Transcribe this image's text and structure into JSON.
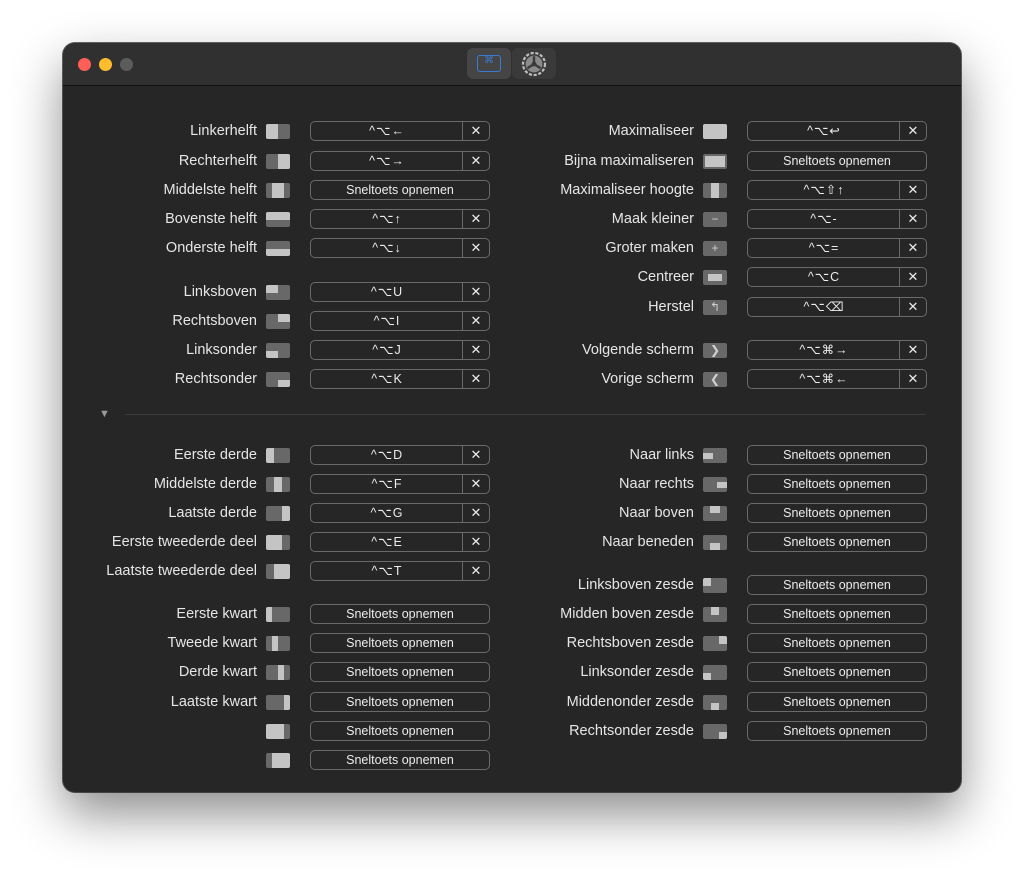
{
  "window": {
    "toolbar": {
      "shortcuts_tab_glyph": "⌘",
      "settings_tab_icon": "gear-icon"
    },
    "accent": "#3a7bd5"
  },
  "x_glyph": "✕",
  "left_top": [
    {
      "label": "Linkerhelft",
      "icon": "left-half",
      "shortcut": "^⌥←"
    },
    {
      "label": "Rechterhelft",
      "icon": "right-half",
      "shortcut": "^⌥→"
    },
    {
      "label": "Middelste helft",
      "icon": "center-half",
      "record": "Sneltoets opnemen"
    },
    {
      "label": "Bovenste helft",
      "icon": "top-half",
      "shortcut": "^⌥↑"
    },
    {
      "label": "Onderste helft",
      "icon": "bottom-half",
      "shortcut": "^⌥↓"
    },
    {
      "label": "Linksboven",
      "icon": "top-left",
      "shortcut": "^⌥U"
    },
    {
      "label": "Rechtsboven",
      "icon": "top-right",
      "shortcut": "^⌥I"
    },
    {
      "label": "Linksonder",
      "icon": "bottom-left",
      "shortcut": "^⌥J"
    },
    {
      "label": "Rechtsonder",
      "icon": "bottom-right",
      "shortcut": "^⌥K"
    }
  ],
  "right_top": [
    {
      "label": "Maximaliseer",
      "icon": "maximize",
      "shortcut": "^⌥↩"
    },
    {
      "label": "Bijna maximaliseren",
      "icon": "almost-maximize",
      "record": "Sneltoets opnemen"
    },
    {
      "label": "Maximaliseer hoogte",
      "icon": "maximize-height",
      "shortcut": "^⌥⇧↑"
    },
    {
      "label": "Maak kleiner",
      "icon": "smaller",
      "shortcut": "^⌥-"
    },
    {
      "label": "Groter maken",
      "icon": "larger",
      "shortcut": "^⌥="
    },
    {
      "label": "Centreer",
      "icon": "center",
      "shortcut": "^⌥C"
    },
    {
      "label": "Herstel",
      "icon": "restore",
      "shortcut": "^⌥⌫"
    },
    {
      "label": "Volgende scherm",
      "icon": "next-display",
      "shortcut": "^⌥⌘→"
    },
    {
      "label": "Vorige scherm",
      "icon": "previous-display",
      "shortcut": "^⌥⌘←"
    }
  ],
  "left_bottom": [
    {
      "label": "Eerste derde",
      "icon": "first-third",
      "shortcut": "^⌥D"
    },
    {
      "label": "Middelste derde",
      "icon": "center-third",
      "shortcut": "^⌥F"
    },
    {
      "label": "Laatste derde",
      "icon": "last-third",
      "shortcut": "^⌥G"
    },
    {
      "label": "Eerste tweederde deel",
      "icon": "first-two-thirds",
      "shortcut": "^⌥E"
    },
    {
      "label": "Laatste tweederde deel",
      "icon": "last-two-thirds",
      "shortcut": "^⌥T"
    },
    {
      "label": "Eerste kwart",
      "icon": "first-fourth",
      "record": "Sneltoets opnemen"
    },
    {
      "label": "Tweede kwart",
      "icon": "second-fourth",
      "record": "Sneltoets opnemen"
    },
    {
      "label": "Derde kwart",
      "icon": "third-fourth",
      "record": "Sneltoets opnemen"
    },
    {
      "label": "Laatste kwart",
      "icon": "last-fourth",
      "record": "Sneltoets opnemen"
    },
    {
      "label": "",
      "icon": "first-three-fourths",
      "record": "Sneltoets opnemen"
    },
    {
      "label": "",
      "icon": "last-three-fourths",
      "record": "Sneltoets opnemen"
    }
  ],
  "right_bottom": [
    {
      "label": "Naar links",
      "icon": "move-left",
      "record": "Sneltoets opnemen"
    },
    {
      "label": "Naar rechts",
      "icon": "move-right",
      "record": "Sneltoets opnemen"
    },
    {
      "label": "Naar boven",
      "icon": "move-up",
      "record": "Sneltoets opnemen"
    },
    {
      "label": "Naar beneden",
      "icon": "move-down",
      "record": "Sneltoets opnemen"
    },
    {
      "label": "Linksboven zesde",
      "icon": "top-left-sixth",
      "record": "Sneltoets opnemen"
    },
    {
      "label": "Midden boven zesde",
      "icon": "top-center-sixth",
      "record": "Sneltoets opnemen"
    },
    {
      "label": "Rechtsboven zesde",
      "icon": "top-right-sixth",
      "record": "Sneltoets opnemen"
    },
    {
      "label": "Linksonder zesde",
      "icon": "bottom-left-sixth",
      "record": "Sneltoets opnemen"
    },
    {
      "label": "Middenonder zesde",
      "icon": "bottom-center-sixth",
      "record": "Sneltoets opnemen"
    },
    {
      "label": "Rechtsonder zesde",
      "icon": "bottom-right-sixth",
      "record": "Sneltoets opnemen"
    }
  ],
  "disclosure_glyph": "▼"
}
